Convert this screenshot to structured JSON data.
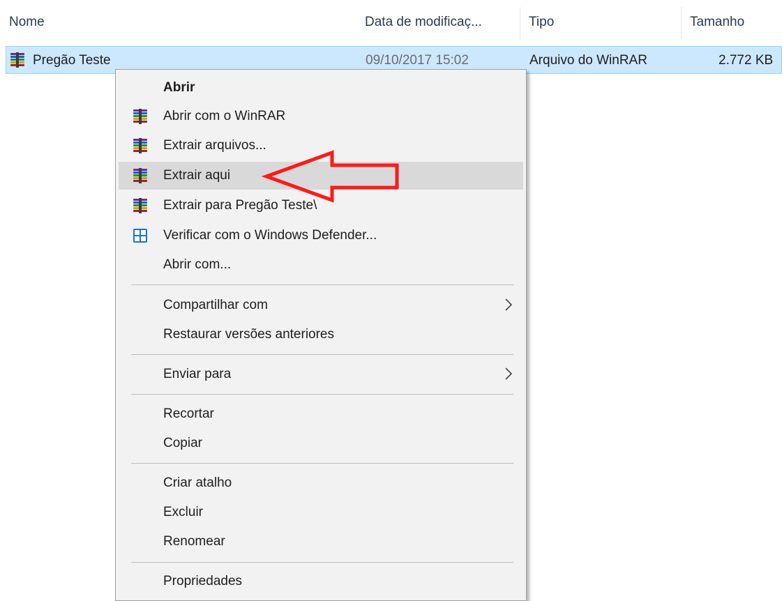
{
  "columns": {
    "name": "Nome",
    "date": "Data de modificaç...",
    "type": "Tipo",
    "size": "Tamanho"
  },
  "file": {
    "name": "Pregão Teste",
    "date": "09/10/2017 15:02",
    "type": "Arquivo do WinRAR",
    "size": "2.772 KB",
    "icon": "winrar-archive-icon"
  },
  "menu": {
    "items": [
      {
        "label": "Abrir",
        "bold": true
      },
      {
        "label": "Abrir com o WinRAR",
        "icon": "winrar-icon"
      },
      {
        "label": "Extrair arquivos...",
        "icon": "winrar-icon"
      },
      {
        "label": "Extrair aqui",
        "icon": "winrar-icon",
        "highlighted": true
      },
      {
        "label": "Extrair para Pregão Teste\\",
        "icon": "winrar-icon"
      },
      {
        "label": "Verificar com o Windows Defender...",
        "icon": "windows-defender-icon"
      },
      {
        "label": "Abrir com..."
      },
      {
        "label": "Compartilhar com",
        "submenu": true
      },
      {
        "label": "Restaurar versões anteriores"
      },
      {
        "label": "Enviar para",
        "submenu": true
      },
      {
        "label": "Recortar"
      },
      {
        "label": "Copiar"
      },
      {
        "label": "Criar atalho"
      },
      {
        "label": "Excluir"
      },
      {
        "label": "Renomear"
      },
      {
        "label": "Propriedades"
      }
    ]
  },
  "colors": {
    "selection": "#cce8ff",
    "menu_bg": "#f2f2f2",
    "hover": "#d9d9d9",
    "annotation_arrow": "#ff1a1a"
  }
}
